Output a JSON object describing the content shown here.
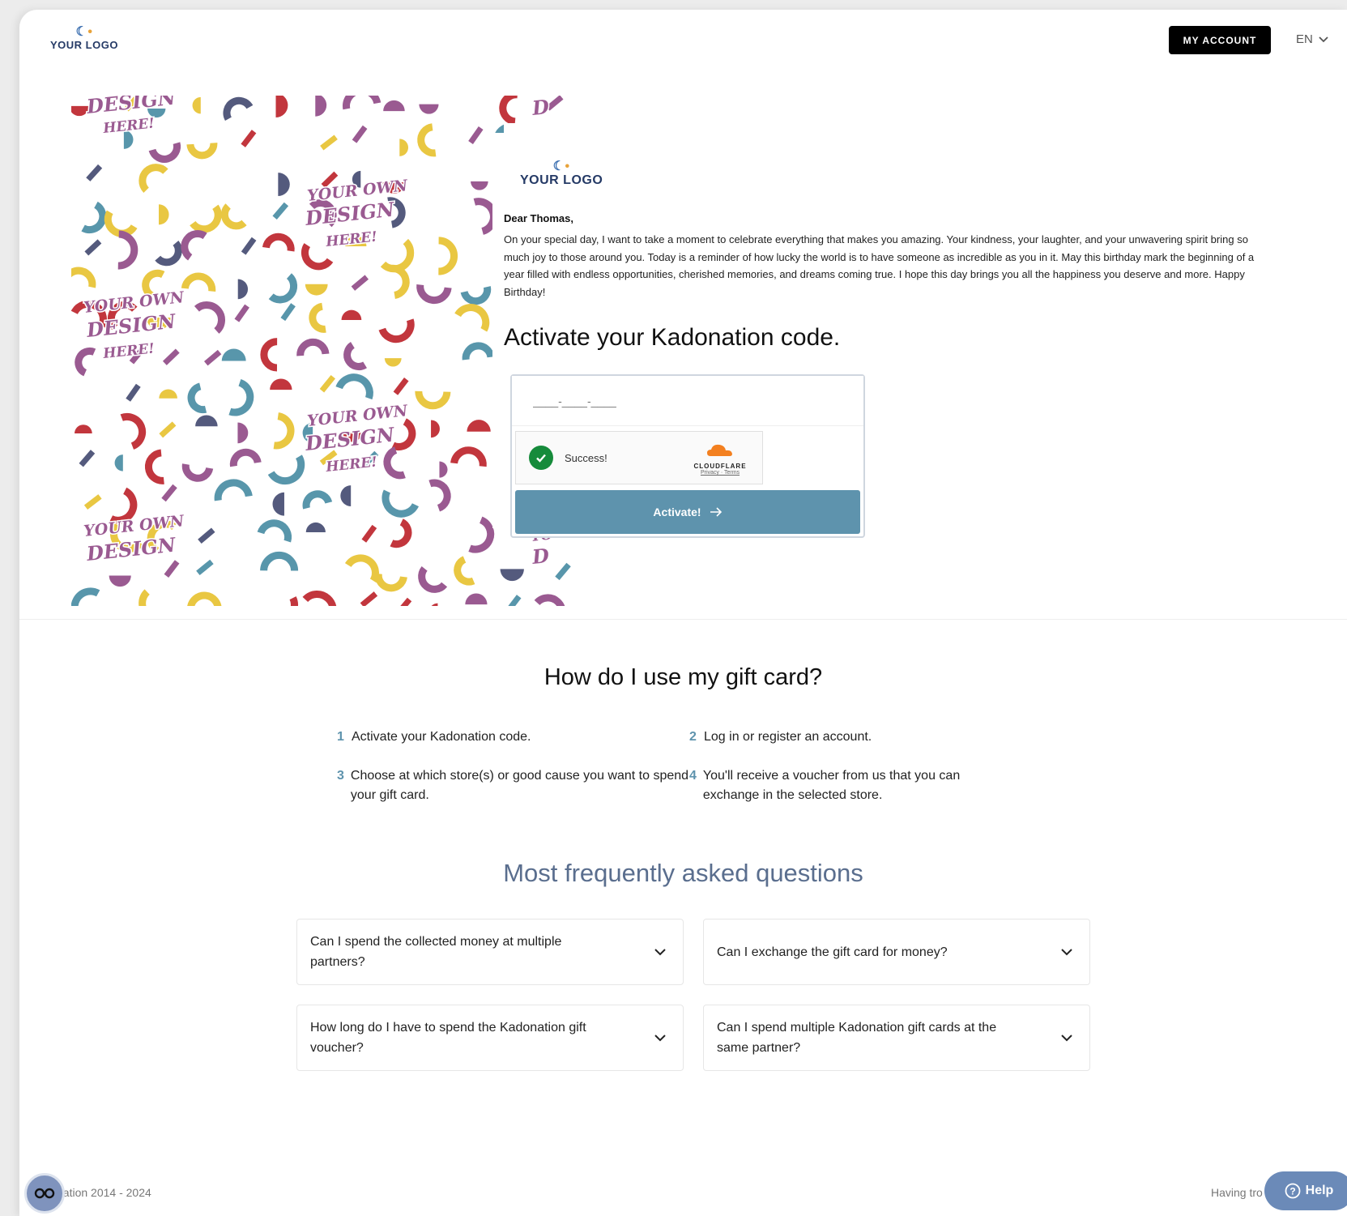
{
  "header": {
    "logo_text": "YOUR LOGO",
    "account_label": "MY ACCOUNT",
    "language": "EN"
  },
  "card": {
    "artwork_text": [
      "DESIGN",
      "HERE!",
      "YOUR OWN",
      "DESIGN",
      "HERE!",
      "YOUR OWN",
      "DESIGN",
      "HERE!",
      "YOUR OWN",
      "DESIGN",
      "HERE!",
      "YOUR OWN",
      "DESIGN",
      "D",
      "YO",
      "D"
    ],
    "logo_text": "YOUR LOGO",
    "greeting": "Dear Thomas,",
    "message": "On your special day, I want to take a moment to celebrate everything that makes you amazing. Your kindness, your laughter, and your unwavering spirit bring so much joy to those around you. Today is a reminder of how lucky the world is to have someone as incredible as you in it. May this birthday mark the beginning of a year filled with endless opportunities, cherished memories, and dreams coming true. I hope this day brings you all the happiness you deserve and more. Happy Birthday!"
  },
  "activation": {
    "title": "Activate your Kadonation code.",
    "code_placeholder": "____-____-____",
    "captcha_status": "Success!",
    "captcha_brand": "CLOUDFLARE",
    "captcha_links": "Privacy · Terms",
    "button_label": "Activate!"
  },
  "how_to": {
    "title": "How do I use my gift card?",
    "steps": [
      {
        "num": "1",
        "text": "Activate your Kadonation code."
      },
      {
        "num": "2",
        "text": "Log in or register an account."
      },
      {
        "num": "3",
        "text": "Choose at which store(s) or good cause you want to spend your gift card."
      },
      {
        "num": "4",
        "text": "You'll receive a voucher from us that you can exchange in the selected store."
      }
    ]
  },
  "faq": {
    "title": "Most frequently asked questions",
    "items": [
      "Can I spend the collected money at multiple partners?",
      "Can I exchange the gift card for money?",
      "How long do I have to spend the Kadonation gift voucher?",
      "Can I spend multiple Kadonation gift cards at the same partner?"
    ]
  },
  "footer": {
    "copyright": "nation 2014 - 2024",
    "trouble_text": "Having tro",
    "help_label": "Help"
  },
  "colors": {
    "accent": "#5e93ad",
    "yellow": "#e9c742",
    "purple": "#9a5a91",
    "red": "#c2363d",
    "teal": "#5896ab",
    "navy": "#545a7d"
  }
}
